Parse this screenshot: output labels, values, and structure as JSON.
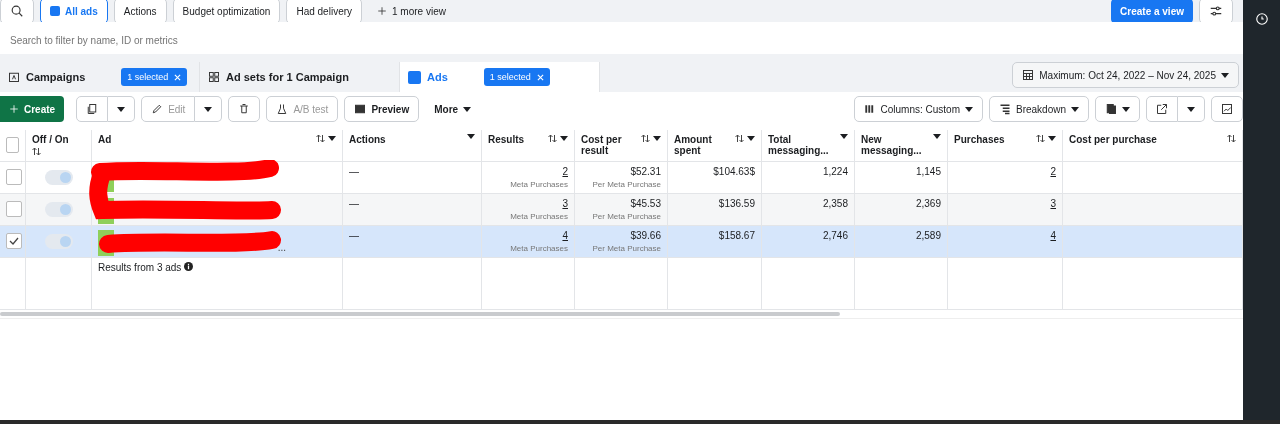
{
  "views": [
    {
      "label": "All ads",
      "selected": true
    },
    {
      "label": "Actions",
      "selected": false
    },
    {
      "label": "Budget optimization",
      "selected": false
    },
    {
      "label": "Had delivery",
      "selected": false
    }
  ],
  "more_views": "1 more view",
  "create_view": "Create a view",
  "search": {
    "placeholder": "Search to filter by name, ID or metrics"
  },
  "levels": [
    {
      "label": "Campaigns",
      "selected": false,
      "chip": "1 selected"
    },
    {
      "label": "Ad sets for 1 Campaign",
      "selected": false
    },
    {
      "label": "Ads",
      "selected": true,
      "chip": "1 selected"
    }
  ],
  "date_range": "Maximum: Oct 24, 2022 – Nov 24, 2025",
  "toolbar": {
    "create": "Create",
    "edit": "Edit",
    "ab_test": "A/B test",
    "preview": "Preview",
    "more": "More",
    "columns": "Columns: Custom",
    "breakdown": "Breakdown"
  },
  "select_all": {
    "checked": false
  },
  "columns": [
    {
      "label": "Off / On",
      "sortable": true,
      "menu": false
    },
    {
      "label": "Ad",
      "sortable": true,
      "menu": true
    },
    {
      "label": "Actions",
      "sortable": false,
      "menu": true
    },
    {
      "label": "Results",
      "sortable": true,
      "menu": true
    },
    {
      "label": "Cost per result",
      "sortable": true,
      "menu": true
    },
    {
      "label": "Amount spent",
      "sortable": true,
      "menu": true
    },
    {
      "label": "Total messaging...",
      "sortable": false,
      "menu": true
    },
    {
      "label": "New messaging...",
      "sortable": false,
      "menu": true
    },
    {
      "label": "Purchases",
      "sortable": true,
      "menu": true
    },
    {
      "label": "Cost per purchase",
      "sortable": true,
      "menu": false
    }
  ],
  "rows": [
    {
      "selected": false,
      "on": true,
      "actions": "—",
      "results": "2",
      "results_sub": "Meta Purchases",
      "cost": "$52.31",
      "cost_sub": "Per Meta Purchase",
      "spent": "$104.63$",
      "total_messaging": "1,224",
      "new_messaging": "1,145",
      "purchases": "2"
    },
    {
      "selected": false,
      "on": true,
      "actions": "—",
      "results": "3",
      "results_sub": "Meta Purchases",
      "cost": "$45.53",
      "cost_sub": "Per Meta Purchase",
      "spent": "$136.59",
      "total_messaging": "2,358",
      "new_messaging": "2,369",
      "purchases": "3"
    },
    {
      "selected": true,
      "on": true,
      "ad_tail": "...",
      "actions": "—",
      "results": "4",
      "results_sub": "Meta Purchases",
      "cost": "$39.66",
      "cost_sub": "Per Meta Purchase",
      "spent": "$158.67",
      "total_messaging": "2,746",
      "new_messaging": "2,589",
      "purchases": "4"
    }
  ],
  "summary": "Results from 3 ads"
}
